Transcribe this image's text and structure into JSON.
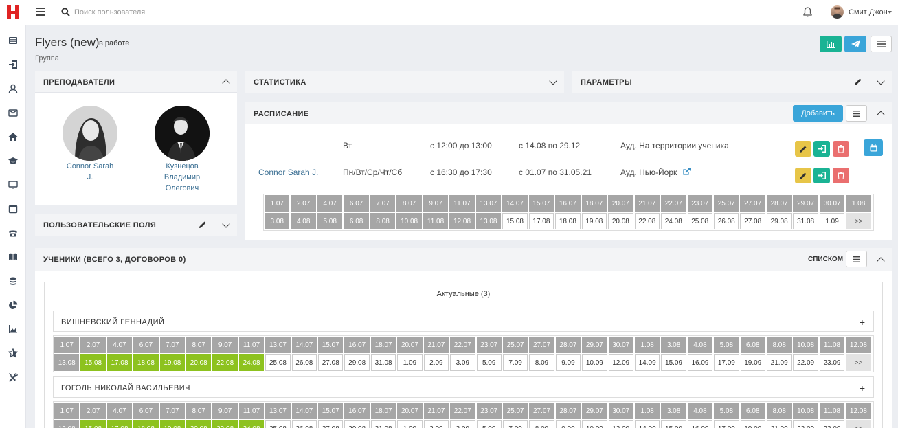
{
  "topbar": {
    "logo": "H",
    "search_placeholder": "Поиск пользователя",
    "user_name": "Смит Джон",
    "icons": [
      "menu-icon",
      "search-icon",
      "bell-icon"
    ]
  },
  "sidebar": {
    "icons": [
      "list-icon",
      "sign-in-icon",
      "user-icon",
      "envelope-icon",
      "home-icon",
      "graduation-cap-icon",
      "desktop-icon",
      "calendar-icon",
      "phone-icon",
      "book-icon",
      "coins-icon",
      "pie-chart-icon",
      "area-chart-icon",
      "star-icon",
      "tools-icon"
    ]
  },
  "page": {
    "title": "Flyers (new)",
    "status": "в работе",
    "subtitle": "Группа"
  },
  "colors": {
    "teal": "#1ab394",
    "blue": "#3aa5d9",
    "yellow": "#e7c548",
    "red": "#ea6f6f",
    "green_cell": "#8dc21f",
    "grey_cell": "#a6a6a6",
    "link": "#3b6f93"
  },
  "teachers": {
    "title": "ПРЕПОДАВАТЕЛИ",
    "items": [
      {
        "name_line1": "Connor Sarah",
        "name_line2": "J.",
        "name_line3": ""
      },
      {
        "name_line1": "Кузнецов",
        "name_line2": "Владимир",
        "name_line3": "Олегович"
      }
    ]
  },
  "custom_fields": {
    "title": "ПОЛЬЗОВАТЕЛЬСКИЕ ПОЛЯ"
  },
  "stats": {
    "title": "СТАТИСТИКА"
  },
  "params": {
    "title": "ПАРАМЕТРЫ"
  },
  "schedule": {
    "title": "РАСПИСАНИЕ",
    "add_label": "Добавить",
    "rows": [
      {
        "teacher": "",
        "days": "Вт",
        "time": "с 12:00 до 13:00",
        "period": "с 14.08 по 29.12",
        "room": "Ауд. На территории ученика"
      },
      {
        "teacher": "Connor Sarah J.",
        "days": "Пн/Вт/Ср/Чт/Сб",
        "time": "с 16:30 до 17:30",
        "period": "с 01.07 по 31.05.21",
        "room": "Ауд. Нью-Йорк"
      }
    ],
    "dates_row1": [
      "1.07",
      "2.07",
      "4.07",
      "6.07",
      "7.07",
      "8.07",
      "9.07",
      "11.07",
      "13.07",
      "14.07",
      "15.07",
      "16.07",
      "18.07",
      "20.07",
      "21.07",
      "22.07",
      "23.07",
      "25.07",
      "27.07",
      "28.07",
      "29.07",
      "30.07",
      "1.08"
    ],
    "dates_row2": [
      "3.08",
      "4.08",
      "5.08",
      "6.08",
      "8.08",
      "10.08",
      "11.08",
      "12.08",
      "13.08",
      "15.08",
      "17.08",
      "18.08",
      "19.08",
      "20.08",
      "22.08",
      "24.08",
      "25.08",
      "26.08",
      "27.08",
      "29.08",
      "31.08",
      "1.09",
      ">>"
    ],
    "row1_past_count": 23,
    "row2_past_count": 9
  },
  "students": {
    "title": "УЧЕНИКИ (ВСЕГО 3, ДОГОВОРОВ 0)",
    "view_label": "СПИСКОМ",
    "tab_label": "Актуальные (3)",
    "dates_row1": [
      "1.07",
      "2.07",
      "4.07",
      "6.07",
      "7.07",
      "8.07",
      "9.07",
      "11.07",
      "13.07",
      "14.07",
      "15.07",
      "16.07",
      "18.07",
      "20.07",
      "21.07",
      "22.07",
      "23.07",
      "25.07",
      "27.07",
      "28.07",
      "29.07",
      "30.07",
      "1.08",
      "3.08",
      "4.08",
      "5.08",
      "6.08",
      "8.08",
      "10.08",
      "11.08",
      "12.08"
    ],
    "dates_row2": [
      "13.08",
      "15.08",
      "17.08",
      "18.08",
      "19.08",
      "20.08",
      "22.08",
      "24.08",
      "25.08",
      "26.08",
      "27.08",
      "29.08",
      "31.08",
      "1.09",
      "2.09",
      "3.09",
      "5.09",
      "7.09",
      "8.09",
      "9.09",
      "10.09",
      "12.09",
      "14.09",
      "15.09",
      "16.09",
      "17.09",
      "19.09",
      "21.09",
      "22.09",
      "23.09",
      ">>"
    ],
    "list": [
      {
        "name": "ВИШНЕВСКИЙ ГЕННАДИЙ",
        "plus": "+"
      },
      {
        "name": "ГОГОЛЬ НИКОЛАЙ ВАСИЛЬЕВИЧ",
        "plus": "+"
      }
    ]
  }
}
